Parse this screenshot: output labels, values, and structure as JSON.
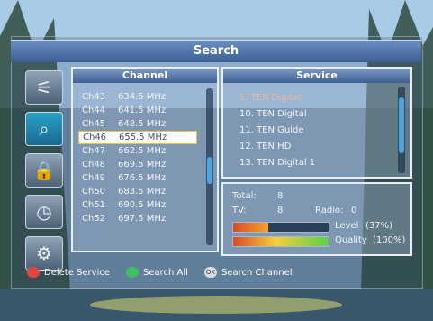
{
  "window": {
    "title": "Search"
  },
  "channel_panel": {
    "header": "Channel",
    "rows": [
      {
        "channel": "Ch43",
        "frequency": "634.5 MHz"
      },
      {
        "channel": "Ch44",
        "frequency": "641.5 MHz"
      },
      {
        "channel": "Ch45",
        "frequency": "648.5 MHz"
      },
      {
        "channel": "Ch46",
        "frequency": "655.5 MHz",
        "selected": true
      },
      {
        "channel": "Ch47",
        "frequency": "662.5 MHz"
      },
      {
        "channel": "Ch48",
        "frequency": "669.5 MHz"
      },
      {
        "channel": "Ch49",
        "frequency": "676.5 MHz"
      },
      {
        "channel": "Ch50",
        "frequency": "683.5 MHz"
      },
      {
        "channel": "Ch51",
        "frequency": "690.5 MHz"
      },
      {
        "channel": "Ch52",
        "frequency": "697.5 MHz"
      }
    ]
  },
  "service_panel": {
    "header": "Service",
    "rows": [
      "1. TEN Digital",
      "10. TEN Digital",
      "11. TEN Guide",
      "12. TEN HD",
      "13. TEN Digital 1"
    ]
  },
  "info_panel": {
    "total_label": "Total:",
    "total_value": "8",
    "tv_label": "TV:",
    "tv_value": "8",
    "radio_label": "Radio:",
    "radio_value": "0",
    "level_label": "Level",
    "level_value": "(37%)",
    "level_fraction": 0.37,
    "quality_label": "Quality",
    "quality_value": "(100%)",
    "quality_fraction": 1.0
  },
  "side_icons": [
    "antenna-icon",
    "search-icon",
    "lock-icon",
    "clock-icon",
    "tools-icon"
  ],
  "footer": {
    "red_label": "Delete Service",
    "green_label": "Search All",
    "ok_key": "OK",
    "ok_label": "Search Channel"
  },
  "colors": {
    "red": "#e0453c",
    "green": "#3fbf5f",
    "accent": "#4fa5de"
  }
}
